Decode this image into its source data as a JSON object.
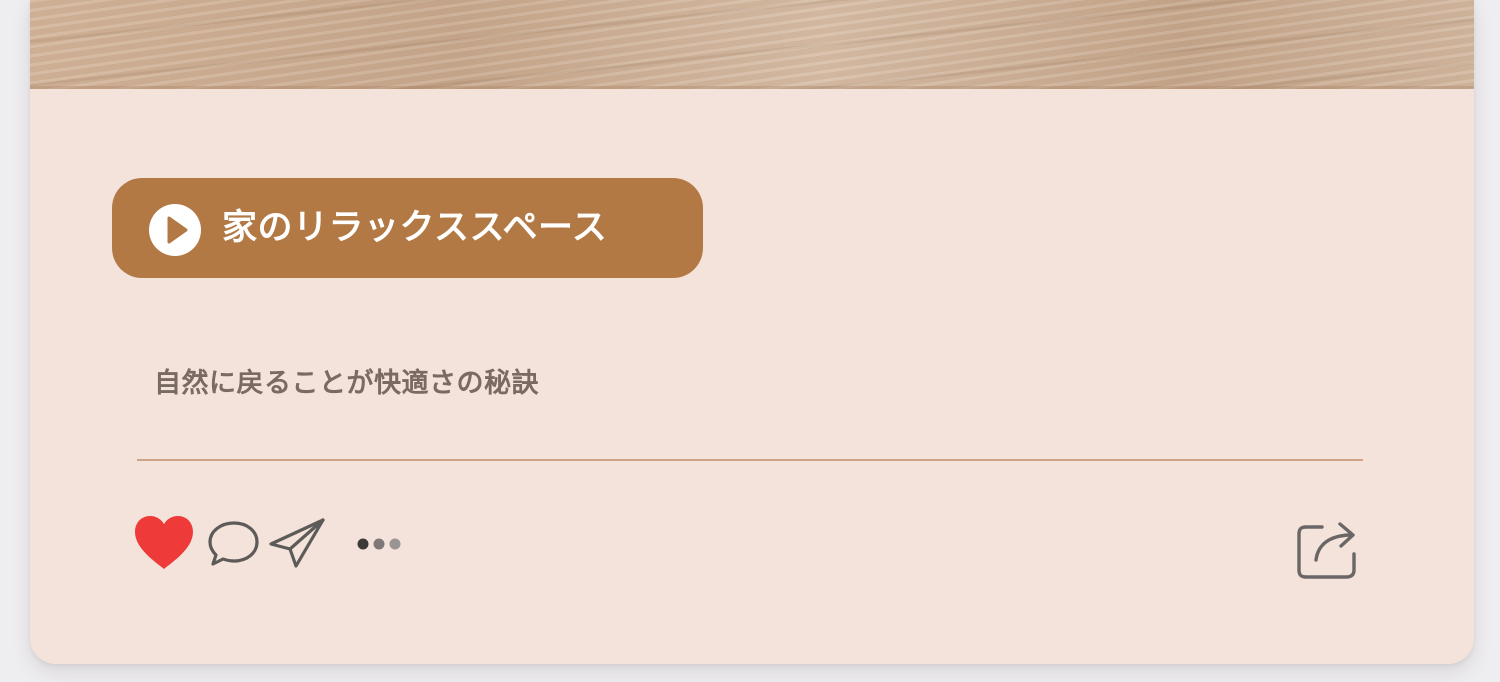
{
  "post": {
    "title": "家のリラックススペース",
    "caption": "自然に戻ることが快適さの秘訣"
  },
  "actions": {
    "play": "play-icon",
    "like": "heart-icon",
    "comment": "comment-icon",
    "send": "paper-plane-icon",
    "more": "more-icon",
    "share": "share-icon"
  },
  "colors": {
    "card_background": "#f4e3da",
    "pill_background": "#b37944",
    "heart": "#ef3a3a",
    "icon_stroke": "#5d5a5a",
    "caption_text": "#7a6a64",
    "divider": "#cfa486"
  }
}
